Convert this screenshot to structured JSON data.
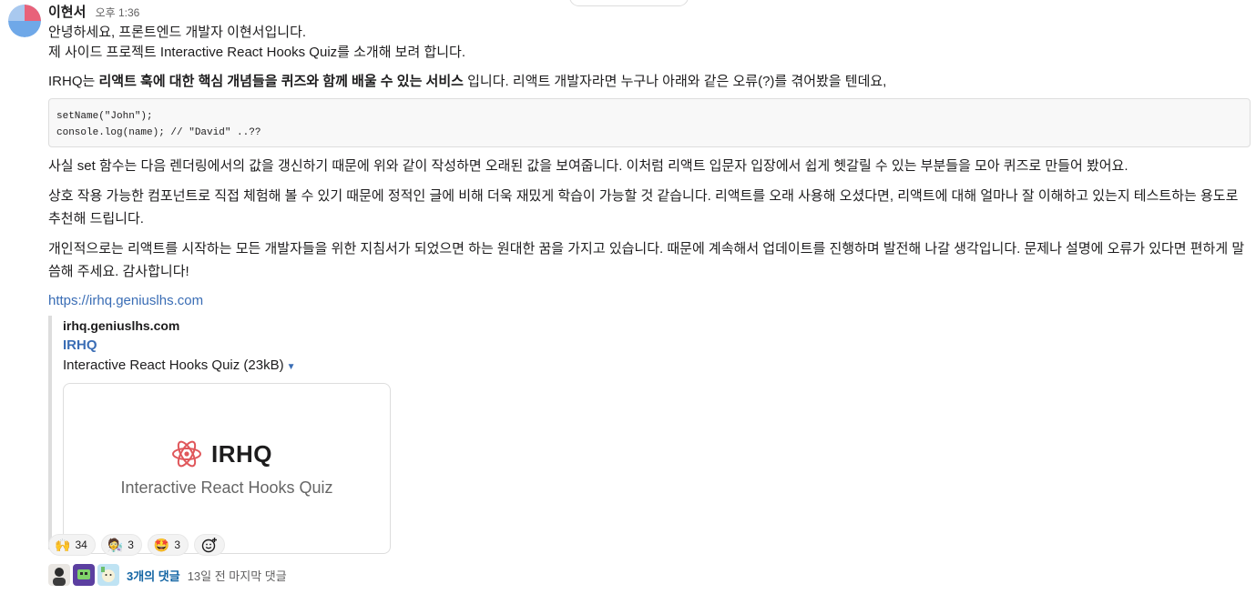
{
  "message": {
    "sender": "이현서",
    "time": "오후 1:36",
    "intro_line1": "안녕하세요, 프론트엔드 개발자 이현서입니다.",
    "intro_line2": "제 사이드 프로젝트 Interactive React Hooks Quiz를 소개해 보려 합니다.",
    "p2_prefix": "IRHQ는 ",
    "p2_bold": "리액트 훅에 대한 핵심 개념들을 퀴즈와 함께 배울 수 있는 서비스",
    "p2_suffix": " 입니다. 리액트 개발자라면 누구나 아래와 같은 오류(?)를 겪어봤을 텐데요,",
    "code_line1": "setName(\"John\");",
    "code_line2": "console.log(name); // \"David\" ..??",
    "p3": "사실 set 함수는 다음 렌더링에서의 값을 갱신하기 때문에 위와 같이 작성하면 오래된 값을 보여줍니다. 이처럼 리액트 입문자 입장에서 쉽게 헷갈릴 수 있는 부분들을 모아 퀴즈로 만들어 봤어요.",
    "p4": "상호 작용 가능한 컴포넌트로 직접 체험해 볼 수 있기 때문에 정적인 글에 비해 더욱 재밌게 학습이 가능할 것 같습니다. 리액트를 오래 사용해 오셨다면, 리액트에 대해 얼마나 잘 이해하고 있는지 테스트하는 용도로 추천해 드립니다.",
    "p5": "개인적으로는 리액트를 시작하는 모든 개발자들을 위한 지침서가 되었으면 하는 원대한 꿈을 가지고 있습니다. 때문에 계속해서 업데이트를 진행하며 발전해 나갈 생각입니다. 문제나 설명에 오류가 있다면 편하게 말씀해 주세요. 감사합니다!",
    "url": "https://irhq.geniuslhs.com"
  },
  "unfurl": {
    "site": "irhq.geniuslhs.com",
    "title": "IRHQ",
    "description": "Interactive React Hooks Quiz (23kB)",
    "card_logo_text": "IRHQ",
    "card_subtitle": "Interactive React Hooks Quiz"
  },
  "reactions": [
    {
      "icon": "raised-hands-icon",
      "emoji": "🙌",
      "count": "34"
    },
    {
      "icon": "scientist-icon",
      "emoji": "🧑‍🔬",
      "count": "3"
    },
    {
      "icon": "star-struck-icon",
      "emoji": "🤩",
      "count": "3"
    }
  ],
  "thread": {
    "replies": "3개의 댓글",
    "last_reply": "13일 전 마지막 댓글"
  },
  "colors": {
    "link": "#3a6db5",
    "react_logo": "#e0575b"
  }
}
